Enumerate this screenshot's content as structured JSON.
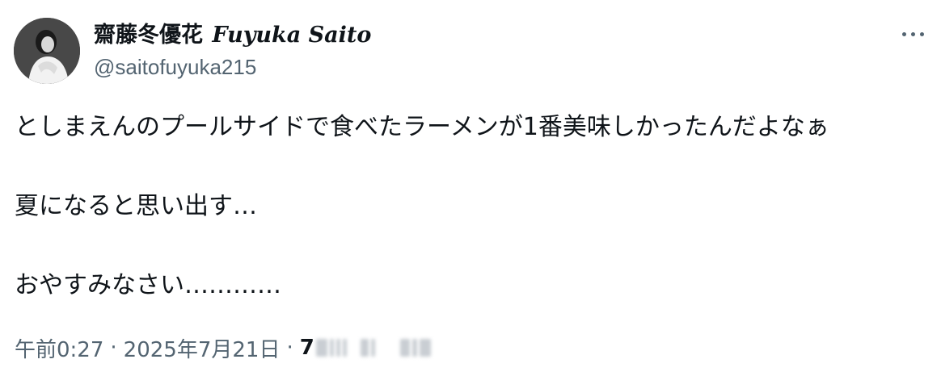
{
  "author": {
    "display_name_jp": "齋藤冬優花",
    "display_name_en": "Fuyuka Saito",
    "handle": "@saitofuyuka215"
  },
  "tweet": {
    "lines": [
      "としまえんのプールサイドで食べたラーメンが1番美味しかったんだよなぁ",
      "夏になると思い出す…",
      "おやすみなさい…………"
    ]
  },
  "meta": {
    "time": "午前0:27",
    "separator": "·",
    "date": "2025年7月21日",
    "views_prefix": "7"
  },
  "icons": {
    "more": "more-horizontal-icon",
    "avatar": "profile-photo"
  },
  "colors": {
    "text": "#0f1419",
    "secondary": "#536471"
  }
}
